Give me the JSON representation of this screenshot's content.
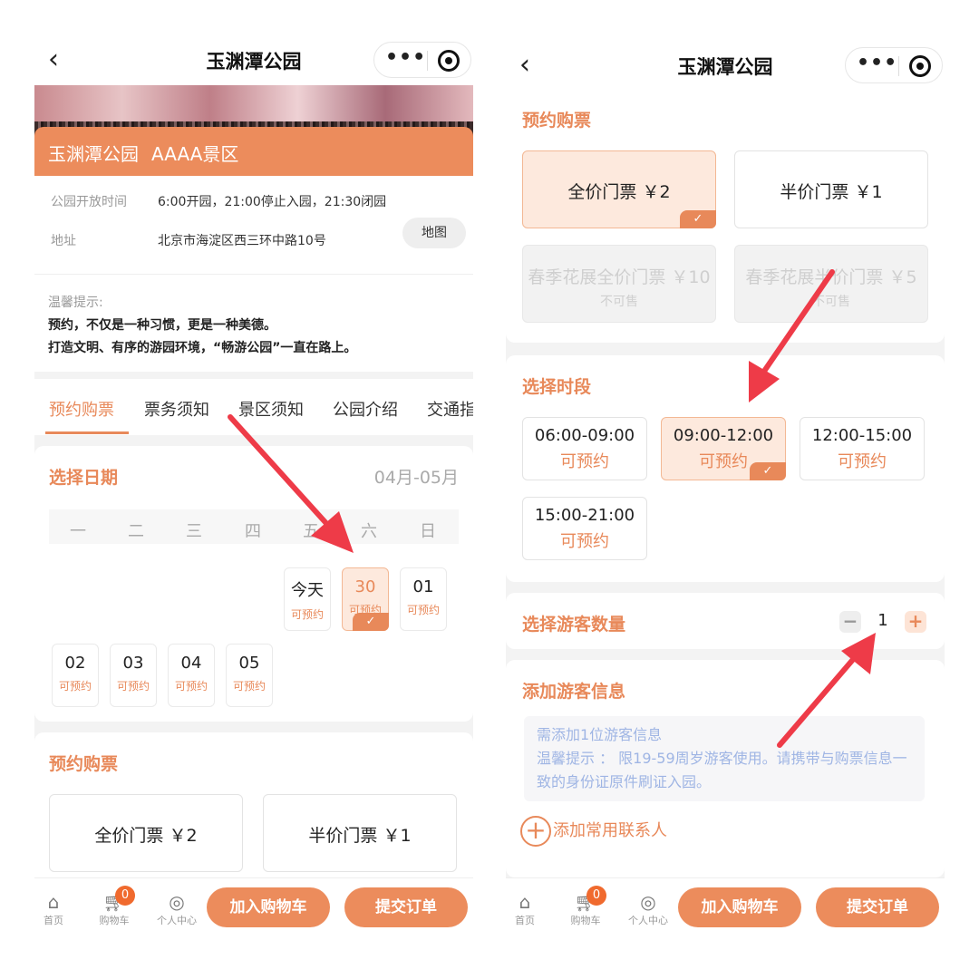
{
  "left": {
    "nav": {
      "back": "‹",
      "title": "玉渊潭公园"
    },
    "banner": {
      "name": "玉渊潭公园",
      "grade": "AAAA景区"
    },
    "info": {
      "hours_label": "公园开放时间",
      "hours_value": "6:00开园，21:00停止入园，21:30闭园",
      "address_label": "地址",
      "address_value": "北京市海淀区西三环中路10号",
      "map_button": "地图"
    },
    "tips": {
      "title": "温馨提示:",
      "line1": "预约，不仅是一种习惯，更是一种美德。",
      "line2": "打造文明、有序的游园环境，“畅游公园”一直在路上。"
    },
    "tabs": [
      "预约购票",
      "票务须知",
      "景区须知",
      "公园介绍",
      "交通指"
    ],
    "date_section": {
      "title": "选择日期",
      "range": "04月-05月"
    },
    "weekdays": [
      "一",
      "二",
      "三",
      "四",
      "五",
      "六",
      "日"
    ],
    "days_row1": [
      {
        "n": "今天",
        "s": "可预约"
      },
      {
        "n": "30",
        "s": "可预约"
      },
      {
        "n": "01",
        "s": "可预约"
      }
    ],
    "days_row2": [
      {
        "n": "02",
        "s": "可预约"
      },
      {
        "n": "03",
        "s": "可预约"
      },
      {
        "n": "04",
        "s": "可预约"
      },
      {
        "n": "05",
        "s": "可预约"
      }
    ],
    "ticket_section": {
      "title": "预约购票"
    },
    "tickets": [
      "全价门票 ￥2",
      "半价门票 ￥1"
    ]
  },
  "right": {
    "nav": {
      "back": "‹",
      "title": "玉渊潭公园"
    },
    "ticket_section": {
      "title": "预约购票"
    },
    "tickets": [
      {
        "label": "全价门票 ￥2",
        "sub": ""
      },
      {
        "label": "半价门票 ￥1",
        "sub": ""
      },
      {
        "label": "春季花展全价门票 ￥10",
        "sub": "不可售"
      },
      {
        "label": "春季花展半价门票 ￥5",
        "sub": "不可售"
      }
    ],
    "slot_section": {
      "title": "选择时段"
    },
    "slots": [
      {
        "time": "06:00-09:00",
        "status": "可预约"
      },
      {
        "time": "09:00-12:00",
        "status": "可预约"
      },
      {
        "time": "12:00-15:00",
        "status": "可预约"
      },
      {
        "time": "15:00-21:00",
        "status": "可预约"
      }
    ],
    "visitor_count": {
      "title": "选择游客数量",
      "minus": "−",
      "value": "1",
      "plus": "+"
    },
    "visitor_info": {
      "title": "添加游客信息",
      "line1": "需添加1位游客信息",
      "line2": "温馨提示 ： 限19-59周岁游客使用。请携带与购票信息一致的身份证原件刷证入园。",
      "add_contact": "添加常用联系人"
    }
  },
  "bottom": {
    "home": "首页",
    "cart": "购物车",
    "cart_badge": "0",
    "profile": "个人中心",
    "add_cart": "加入购物车",
    "submit": "提交订单"
  },
  "colors": {
    "accent": "#e8895a",
    "arrow": "#ee3b48"
  }
}
